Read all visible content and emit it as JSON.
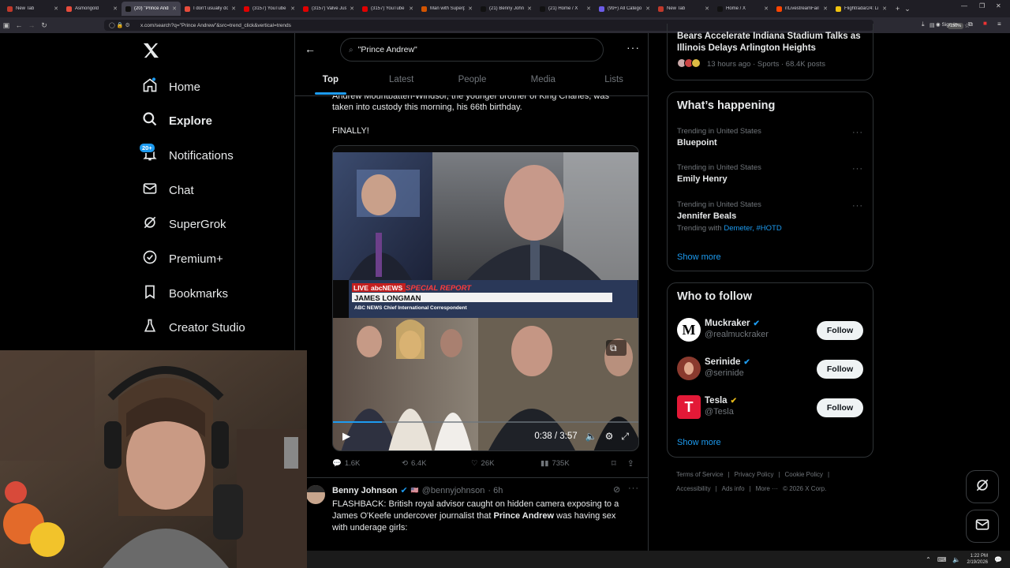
{
  "browser": {
    "tabs": [
      {
        "label": "New Tab",
        "color": "#c0392b",
        "active": false
      },
      {
        "label": "Asmongold",
        "color": "#e74c3c",
        "active": false
      },
      {
        "label": "(20) \"Prince Andr",
        "color": "#111111",
        "active": true
      },
      {
        "label": "I don't usually do",
        "color": "#e74c3c",
        "active": false
      },
      {
        "label": "(3157) YouTube",
        "color": "#e00000",
        "active": false
      },
      {
        "label": "(3157) Valve Just",
        "color": "#e00000",
        "active": false
      },
      {
        "label": "(3157) YouTube",
        "color": "#e00000",
        "active": false
      },
      {
        "label": "Man with Superp",
        "color": "#d35400",
        "active": false
      },
      {
        "label": "(21) Benny Johns",
        "color": "#111111",
        "active": false
      },
      {
        "label": "(21) Home / X",
        "color": "#111111",
        "active": false
      },
      {
        "label": "(99+) All Catego",
        "color": "#6c5ce7",
        "active": false
      },
      {
        "label": "New Tab",
        "color": "#c0392b",
        "active": false
      },
      {
        "label": "Home / X",
        "color": "#111111",
        "active": false
      },
      {
        "label": "r/LivestreamFail",
        "color": "#ff4500",
        "active": false
      },
      {
        "label": "Flightradar24: Li",
        "color": "#f1c40f",
        "active": false
      }
    ],
    "url": "x.com/search?q=\"Prince Andrew\"&src=trend_click&vertical=trends",
    "zoom": "150%",
    "signin": "Sign in"
  },
  "nav": {
    "items": [
      {
        "label": "Home"
      },
      {
        "label": "Explore"
      },
      {
        "label": "Notifications"
      },
      {
        "label": "Chat"
      },
      {
        "label": "SuperGrok"
      },
      {
        "label": "Premium+"
      },
      {
        "label": "Bookmarks"
      },
      {
        "label": "Creator Studio"
      }
    ],
    "notif_badge": "20+"
  },
  "search": {
    "query": "\"Prince Andrew\""
  },
  "tabs": [
    "Top",
    "Latest",
    "People",
    "Media",
    "Lists"
  ],
  "tweet1": {
    "text_line1": "Andrew Mountbatten-Windsor, the younger brother of King Charles, was",
    "text_line2": "taken into custody this morning, his 66th birthday.",
    "text_line3": "FINALLY!",
    "video": {
      "lower_third_live": "LIVE",
      "lower_third_network": "abcNEWS",
      "lower_third_special": "SPECIAL REPORT",
      "lower_third_name": "JAMES LONGMAN",
      "lower_third_title": "ABC NEWS Chief International Correspondent",
      "time": "0:38 / 3:57",
      "progress": 0.16
    },
    "replies": "1.6K",
    "reposts": "6.4K",
    "likes": "26K",
    "views": "735K"
  },
  "tweet2": {
    "author": "Benny Johnson",
    "handle": "@bennyjohnson",
    "time": "· 6h",
    "text_a": "FLASHBACK: British royal advisor caught on hidden camera exposing to a",
    "text_b": "James O'Keefe undercover journalist that ",
    "text_bold": "Prince Andrew",
    "text_c": " was having sex",
    "text_d": "with underage girls:"
  },
  "right": {
    "top_trend_title_1": "Bears Accelerate Indiana Stadium Talks as",
    "top_trend_title_2": "Illinois Delays Arlington Heights",
    "top_trend_meta": "13 hours ago · Sports · 68.4K posts",
    "happening_title": "What’s happening",
    "trends": [
      {
        "category": "Trending in United States",
        "name": "Bluepoint"
      },
      {
        "category": "Trending in United States",
        "name": "Emily Henry"
      },
      {
        "category": "Trending in United States",
        "name": "Jennifer Beals",
        "with_prefix": "Trending with ",
        "with_links": "Demeter, #HOTD"
      }
    ],
    "show_more": "Show more",
    "who_title": "Who to follow",
    "follow": [
      {
        "name": "Muckraker",
        "handle": "@realmuckraker",
        "verified": "blue"
      },
      {
        "name": "Serinide",
        "handle": "@serinide",
        "verified": "blue"
      },
      {
        "name": "Tesla",
        "handle": "@Tesla",
        "verified": "gold"
      }
    ],
    "follow_label": "Follow",
    "show_more_2": "Show more",
    "footer_row1": [
      "Terms of Service",
      "|",
      "Privacy Policy",
      "|",
      "Cookie Policy",
      "|"
    ],
    "footer_row2": [
      "Accessibility",
      "|",
      "Ads info",
      "|",
      "More ···",
      "© 2026 X Corp."
    ]
  },
  "taskbar": {
    "time": "1:22 PM",
    "date": "2/19/2026"
  },
  "colors": {
    "accent": "#1d9bf0",
    "background": "#000000",
    "border": "#2f3336"
  }
}
